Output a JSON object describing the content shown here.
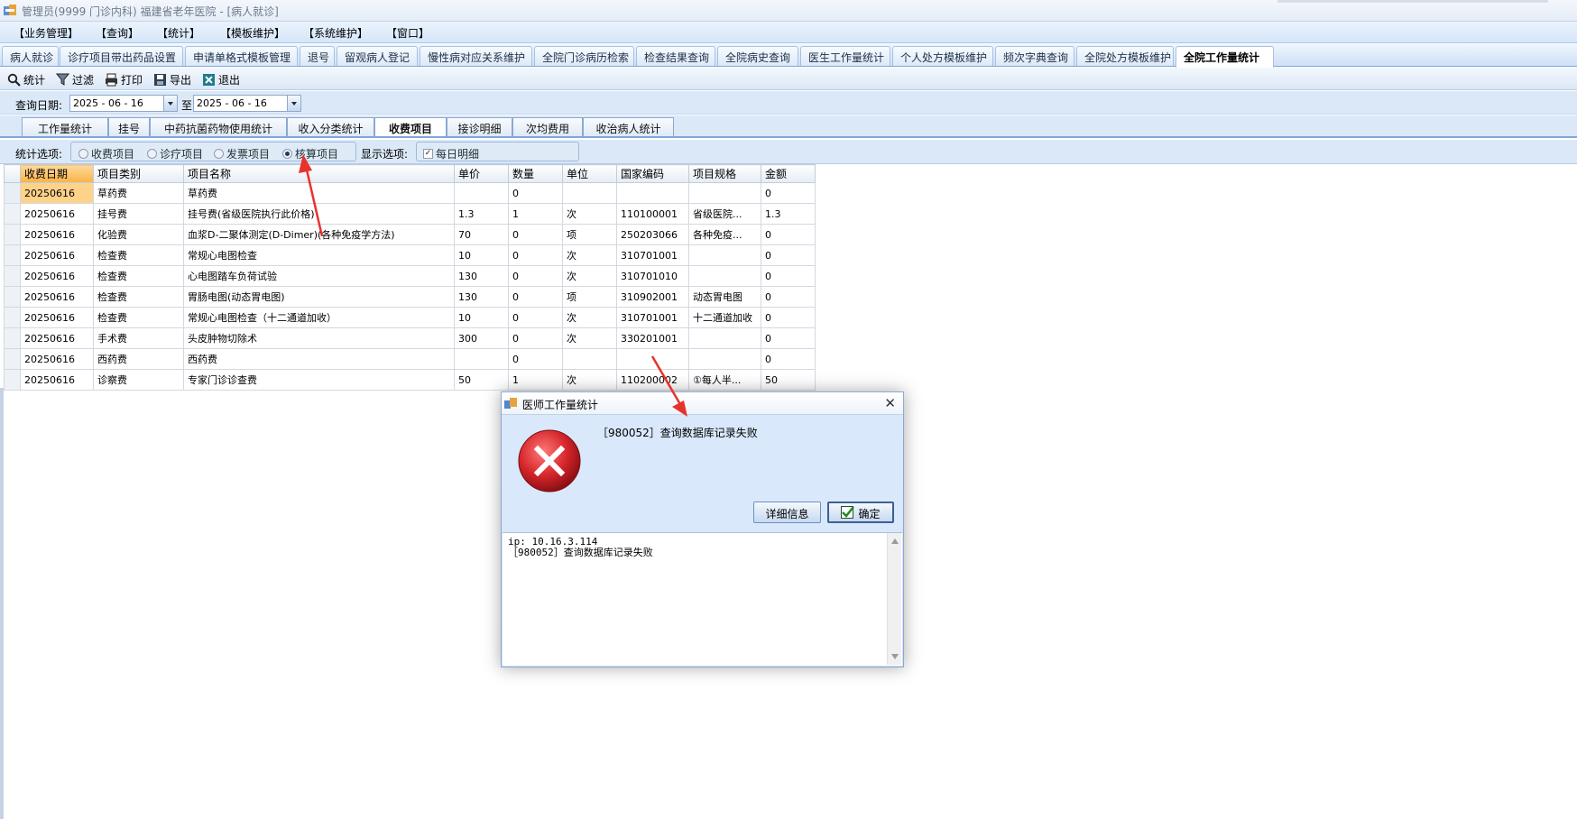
{
  "window": {
    "title": "管理员(9999 门诊内科) 福建省老年医院 - [病人就诊]"
  },
  "menubar": [
    "【业务管理】",
    "【查询】",
    "【统计】",
    "【模板维护】",
    "【系统维护】",
    "【窗口】"
  ],
  "module_tabs": [
    "病人就诊",
    "诊疗项目带出药品设置",
    "申请单格式模板管理",
    "退号",
    "留观病人登记",
    "慢性病对应关系维护",
    "全院门诊病历检索",
    "检查结果查询",
    "全院病史查询",
    "医生工作量统计",
    "个人处方模板维护",
    "频次字典查询",
    "全院处方模板维护",
    "全院工作量统计"
  ],
  "toolbar": {
    "stat": "统计",
    "filter": "过滤",
    "print": "打印",
    "export": "导出",
    "exit": "退出"
  },
  "query": {
    "label": "查询日期:",
    "from": "2025 - 06 - 16",
    "to_label": "至",
    "to": "2025 - 06 - 16"
  },
  "sub_tabs": [
    "工作量统计",
    "挂号",
    "中药抗菌药物使用统计",
    "收入分类统计",
    "收费项目",
    "接诊明细",
    "次均费用",
    "收治病人统计"
  ],
  "options": {
    "label": "统计选项:",
    "radios": [
      "收费项目",
      "诊疗项目",
      "发票项目",
      "核算项目"
    ],
    "selected": "核算项目",
    "display_label": "显示选项:",
    "daily_detail": "每日明细",
    "daily_checked": true
  },
  "grid": {
    "columns": [
      "收费日期",
      "项目类别",
      "项目名称",
      "单价",
      "数量",
      "单位",
      "国家编码",
      "项目规格",
      "金额"
    ],
    "rows": [
      [
        "20250616",
        "草药费",
        "草药费",
        "",
        "0",
        "",
        "",
        "",
        "0"
      ],
      [
        "20250616",
        "挂号费",
        "挂号费(省级医院执行此价格)",
        "1.3",
        "1",
        "次",
        "110100001",
        "省级医院...",
        "1.3"
      ],
      [
        "20250616",
        "化验费",
        "血浆D-二聚体测定(D-Dimer)(各种免疫学方法)",
        "70",
        "0",
        "项",
        "250203066",
        "各种免疫...",
        "0"
      ],
      [
        "20250616",
        "检查费",
        "常规心电图检查",
        "10",
        "0",
        "次",
        "310701001",
        "",
        "0"
      ],
      [
        "20250616",
        "检查费",
        "心电图踏车负荷试验",
        "130",
        "0",
        "次",
        "310701010",
        "",
        "0"
      ],
      [
        "20250616",
        "检查费",
        "胃肠电图(动态胃电图)",
        "130",
        "0",
        "项",
        "310902001",
        "动态胃电图",
        "0"
      ],
      [
        "20250616",
        "检查费",
        "常规心电图检查（十二通道加收）",
        "10",
        "0",
        "次",
        "310701001",
        "十二通道加收",
        "0"
      ],
      [
        "20250616",
        "手术费",
        "头皮肿物切除术",
        "300",
        "0",
        "次",
        "330201001",
        "",
        "0"
      ],
      [
        "20250616",
        "西药费",
        "西药费",
        "",
        "0",
        "",
        "",
        "",
        "0"
      ],
      [
        "20250616",
        "诊察费",
        "专家门诊诊查费",
        "50",
        "1",
        "次",
        "110200002",
        "①每人半...",
        "50"
      ]
    ]
  },
  "dialog": {
    "title": "医师工作量统计",
    "message": "［980052］查询数据库记录失败",
    "details_button": "详细信息",
    "ok_button": "确定",
    "detail_text": "ip: 10.16.3.114\n［980052］查询数据库记录失败"
  },
  "colors": {
    "annotation_arrow": "#e8322c",
    "error_red": "#d5262b",
    "header_selected": "#f7b347"
  }
}
